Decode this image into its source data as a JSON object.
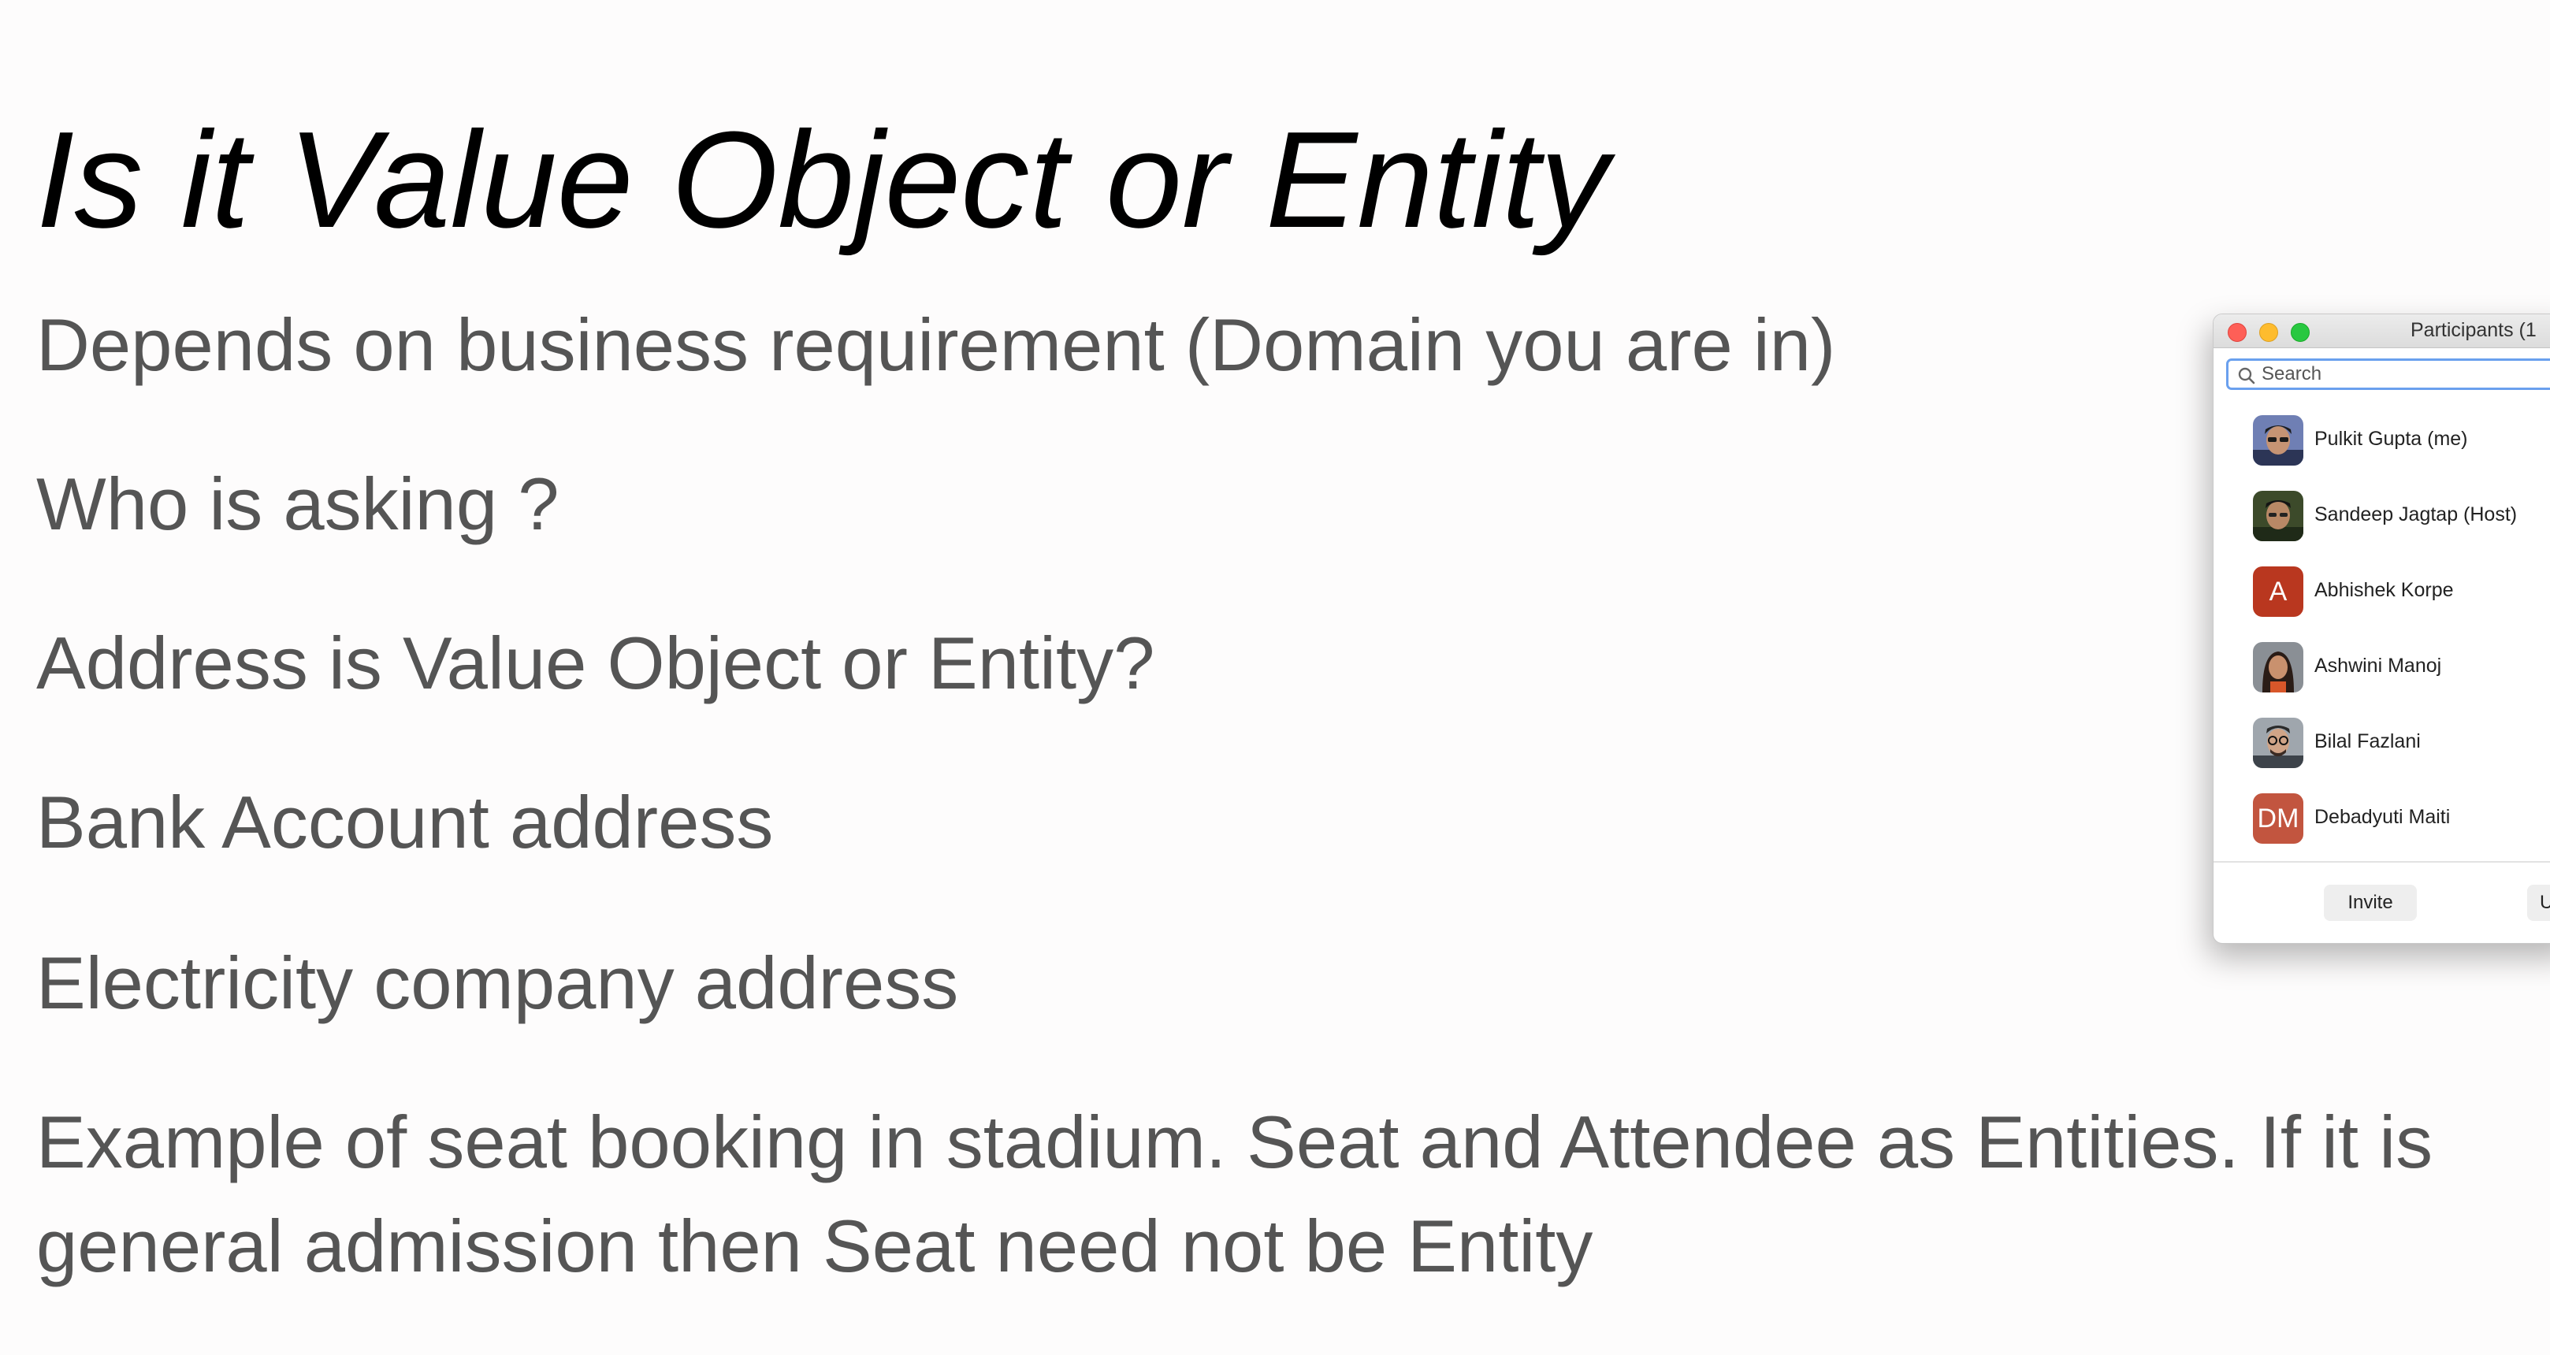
{
  "slide": {
    "title": "Is it Value Object or Entity",
    "bullets": [
      "Depends on business requirement (Domain you are in)",
      "Who is asking ?",
      "Address is Value Object or Entity?",
      "Bank Account address",
      "Electricity company address",
      "Example of  seat booking in stadium. Seat and Attendee as Entities. If it is general admission then Seat need not be Entity"
    ]
  },
  "participants_window": {
    "title": "Participants (1",
    "search": {
      "placeholder": "Search",
      "value": ""
    },
    "participants": [
      {
        "name": "Pulkit Gupta (me)",
        "avatar": "photo"
      },
      {
        "name": "Sandeep Jagtap (Host)",
        "avatar": "photo"
      },
      {
        "name": "Abhishek Korpe",
        "avatar": "letter",
        "initials": "A",
        "color": "#b9371f"
      },
      {
        "name": "Ashwini Manoj",
        "avatar": "photo"
      },
      {
        "name": "Bilal Fazlani",
        "avatar": "photo"
      },
      {
        "name": "Debadyuti Maiti",
        "avatar": "letter",
        "initials": "DM",
        "color": "#c2553f"
      }
    ],
    "buttons": {
      "invite": "Invite",
      "second": "U"
    }
  }
}
